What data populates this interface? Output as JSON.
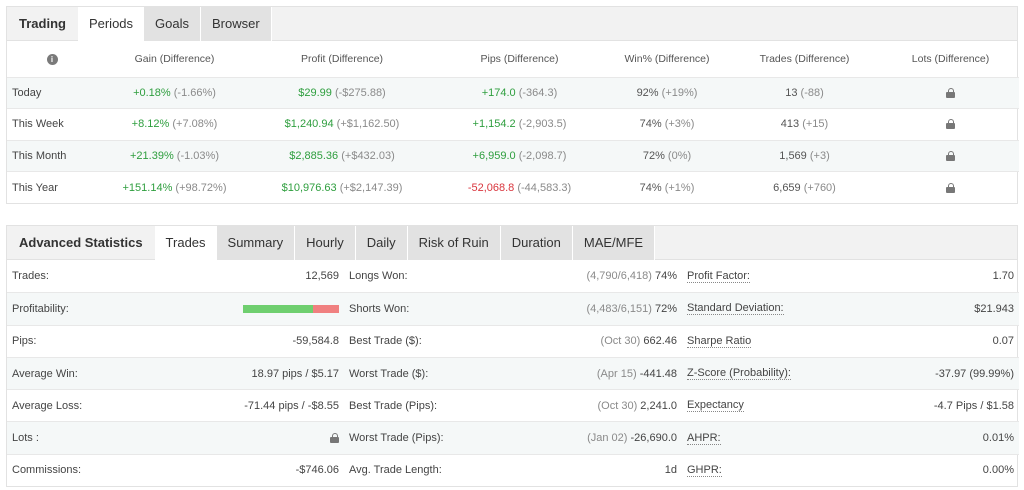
{
  "periods_panel": {
    "tabs": [
      "Trading",
      "Periods",
      "Goals",
      "Browser"
    ],
    "columns": [
      "Gain (Difference)",
      "Profit (Difference)",
      "Pips (Difference)",
      "Win% (Difference)",
      "Trades (Difference)",
      "Lots (Difference)"
    ],
    "rows": [
      {
        "label": "Today",
        "gain": "+0.18%",
        "gain_diff": "(-1.66%)",
        "profit": "$29.99",
        "profit_diff": "(-$275.88)",
        "pips": "+174.0",
        "pips_diff": "(-364.3)",
        "pips_sign": "pos",
        "win": "92%",
        "win_diff": "(+19%)",
        "trades": "13",
        "trades_diff": "(-88)"
      },
      {
        "label": "This Week",
        "gain": "+8.12%",
        "gain_diff": "(+7.08%)",
        "profit": "$1,240.94",
        "profit_diff": "(+$1,162.50)",
        "pips": "+1,154.2",
        "pips_diff": "(-2,903.5)",
        "pips_sign": "pos",
        "win": "74%",
        "win_diff": "(+3%)",
        "trades": "413",
        "trades_diff": "(+15)"
      },
      {
        "label": "This Month",
        "gain": "+21.39%",
        "gain_diff": "(-1.03%)",
        "profit": "$2,885.36",
        "profit_diff": "(+$432.03)",
        "pips": "+6,959.0",
        "pips_diff": "(-2,098.7)",
        "pips_sign": "pos",
        "win": "72%",
        "win_diff": "(0%)",
        "trades": "1,569",
        "trades_diff": "(+3)"
      },
      {
        "label": "This Year",
        "gain": "+151.14%",
        "gain_diff": "(+98.72%)",
        "profit": "$10,976.63",
        "profit_diff": "(+$2,147.39)",
        "pips": "-52,068.8",
        "pips_diff": "(-44,583.3)",
        "pips_sign": "neg",
        "win": "74%",
        "win_diff": "(+1%)",
        "trades": "6,659",
        "trades_diff": "(+760)"
      }
    ]
  },
  "advanced_panel": {
    "title": "Advanced Statistics",
    "tabs": [
      "Trades",
      "Summary",
      "Hourly",
      "Daily",
      "Risk of Ruin",
      "Duration",
      "MAE/MFE"
    ],
    "col1": [
      {
        "label": "Trades:",
        "value": "12,569"
      },
      {
        "label": "Profitability:",
        "value": ""
      },
      {
        "label": "Pips:",
        "value": "-59,584.8"
      },
      {
        "label": "Average Win:",
        "value": "18.97 pips / $5.17"
      },
      {
        "label": "Average Loss:",
        "value": "-71.44 pips / -$8.55"
      },
      {
        "label": "Lots :",
        "value": ""
      },
      {
        "label": "Commissions:",
        "value": "-$746.06"
      }
    ],
    "profitability_won_pct": 73,
    "col2": [
      {
        "label": "Longs Won:",
        "paren": "(4,790/6,418)",
        "value": "74%"
      },
      {
        "label": "Shorts Won:",
        "paren": "(4,483/6,151)",
        "value": "72%"
      },
      {
        "label": "Best Trade ($):",
        "paren": "(Oct 30)",
        "value": "662.46"
      },
      {
        "label": "Worst Trade ($):",
        "paren": "(Apr 15)",
        "value": "-441.48"
      },
      {
        "label": "Best Trade (Pips):",
        "paren": "(Oct 30)",
        "value": "2,241.0"
      },
      {
        "label": "Worst Trade (Pips):",
        "paren": "(Jan 02)",
        "value": "-26,690.0"
      },
      {
        "label": "Avg. Trade Length:",
        "paren": "",
        "value": "1d"
      }
    ],
    "col3": [
      {
        "label": "Profit Factor:",
        "value": "1.70"
      },
      {
        "label": "Standard Deviation:",
        "value": "$21.943"
      },
      {
        "label": "Sharpe Ratio",
        "value": "0.07"
      },
      {
        "label": "Z-Score (Probability):",
        "value": "-37.97 (99.99%)"
      },
      {
        "label": "Expectancy",
        "value": "-4.7 Pips / $1.58"
      },
      {
        "label": "AHPR:",
        "value": "0.01%"
      },
      {
        "label": "GHPR:",
        "value": "0.00%"
      }
    ]
  },
  "colors": {
    "positive": "#2e9e3e",
    "negative": "#d9363e",
    "bar_won": "#6fcf6f",
    "bar_lost": "#f08080"
  },
  "icons": {
    "header_info": "info-icon",
    "locked": "lock-icon"
  }
}
